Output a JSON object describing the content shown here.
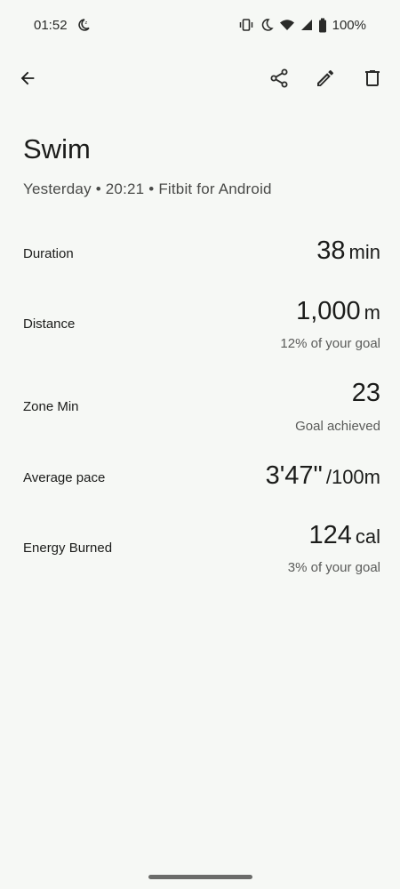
{
  "status_bar": {
    "time": "01:52",
    "battery": "100%",
    "icons": [
      "dnd-moon-icon",
      "vibrate-icon",
      "night-mode-icon",
      "wifi-icon",
      "signal-icon",
      "battery-icon"
    ]
  },
  "toolbar": {
    "back_icon": "arrow-back-icon",
    "share_icon": "share-icon",
    "edit_icon": "pencil-icon",
    "delete_icon": "trash-icon"
  },
  "activity": {
    "title": "Swim",
    "subtitle": "Yesterday • 20:21 • Fitbit for Android"
  },
  "metrics": [
    {
      "label": "Duration",
      "value": "38",
      "unit": "min",
      "sub": ""
    },
    {
      "label": "Distance",
      "value": "1,000",
      "unit": "m",
      "sub": "12% of your goal"
    },
    {
      "label": "Zone Min",
      "value": "23",
      "unit": "",
      "sub": "Goal achieved"
    },
    {
      "label": "Average pace",
      "value": "3'47\"",
      "unit": "/100m",
      "sub": ""
    },
    {
      "label": "Energy Burned",
      "value": "124",
      "unit": "cal",
      "sub": "3% of your goal"
    }
  ]
}
